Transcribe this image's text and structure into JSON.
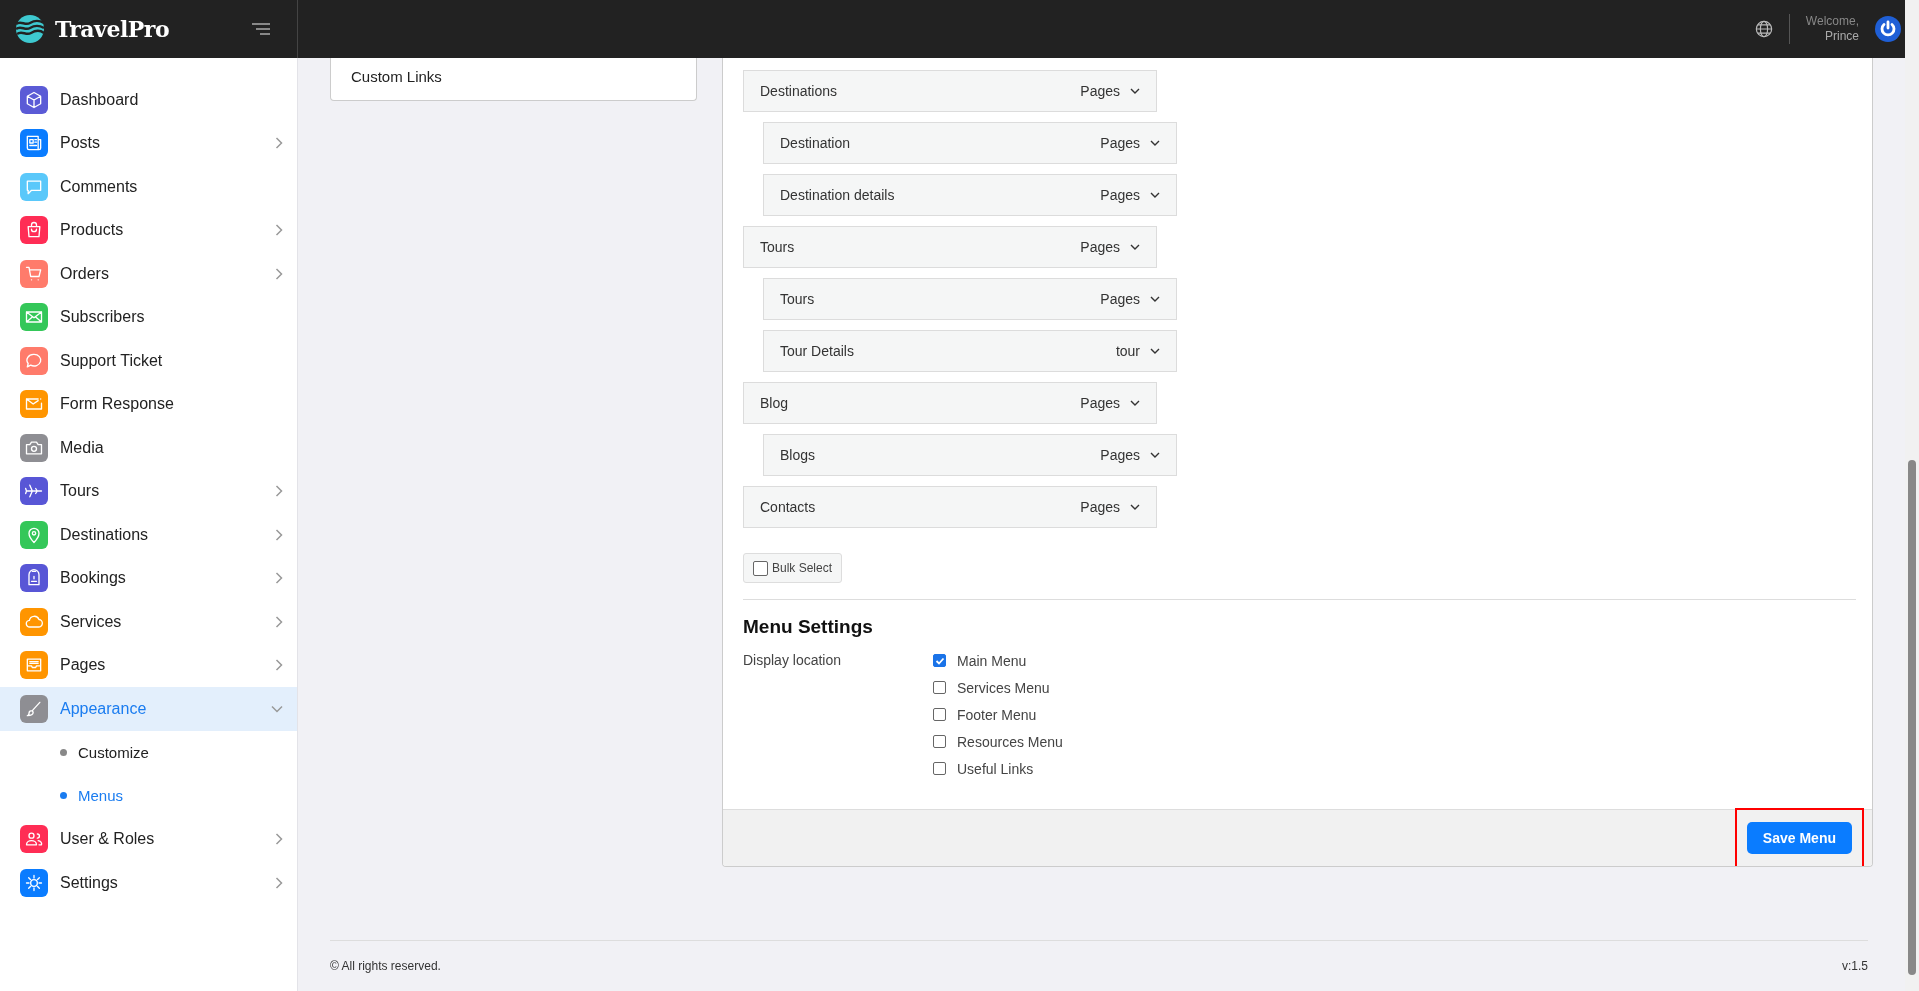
{
  "header": {
    "logo": "TravelPro",
    "welcome": "Welcome,",
    "user": "Prince"
  },
  "sidebar": {
    "items": [
      {
        "label": "Dashboard",
        "color": "#5b5bd6",
        "selected": false
      },
      {
        "label": "Posts",
        "color": "#0a7cff",
        "expanded": false,
        "selected": false
      },
      {
        "label": "Comments",
        "color": "#5ac8fa",
        "selected": false
      },
      {
        "label": "Products",
        "color": "#ff2d55",
        "expanded": false,
        "selected": false
      },
      {
        "label": "Orders",
        "color": "#ff7b6b",
        "expanded": false,
        "selected": false
      },
      {
        "label": "Subscribers",
        "color": "#34c759",
        "selected": false
      },
      {
        "label": "Support Ticket",
        "color": "#ff7b6b",
        "selected": false
      },
      {
        "label": "Form Response",
        "color": "#ff9500",
        "selected": false
      },
      {
        "label": "Media",
        "color": "#8e8e93",
        "selected": false
      },
      {
        "label": "Tours",
        "color": "#5856d6",
        "expanded": false,
        "selected": false
      },
      {
        "label": "Destinations",
        "color": "#34c759",
        "expanded": false,
        "selected": false
      },
      {
        "label": "Bookings",
        "color": "#5856d6",
        "expanded": false,
        "selected": false
      },
      {
        "label": "Services",
        "color": "#ff9500",
        "expanded": false,
        "selected": false
      },
      {
        "label": "Pages",
        "color": "#ff9500",
        "expanded": false,
        "selected": false
      },
      {
        "label": "Appearance",
        "color": "#8e8e93",
        "expanded": true,
        "selected": true,
        "children": [
          {
            "label": "Customize",
            "selected": false
          },
          {
            "label": "Menus",
            "selected": true
          }
        ]
      },
      {
        "label": "User & Roles",
        "color": "#ff2d55",
        "expanded": false,
        "selected": false
      },
      {
        "label": "Settings",
        "color": "#0a7cff",
        "expanded": false,
        "selected": false
      }
    ]
  },
  "left_panel": {
    "title": "Custom Links"
  },
  "menu_structure": {
    "items": [
      {
        "label": "Destinations",
        "type": "Pages",
        "children": [
          {
            "label": "Destination",
            "type": "Pages"
          },
          {
            "label": "Destination details",
            "type": "Pages"
          }
        ]
      },
      {
        "label": "Tours",
        "type": "Pages",
        "children": [
          {
            "label": "Tours",
            "type": "Pages"
          },
          {
            "label": "Tour Details",
            "type": "tour"
          }
        ]
      },
      {
        "label": "Blog",
        "type": "Pages",
        "children": [
          {
            "label": "Blogs",
            "type": "Pages"
          }
        ]
      },
      {
        "label": "Contacts",
        "type": "Pages"
      }
    ]
  },
  "bulk_select": {
    "label": "Bulk Select",
    "checked": false
  },
  "menu_settings": {
    "title": "Menu Settings",
    "display_location_label": "Display location",
    "locations": [
      {
        "label": "Main Menu",
        "checked": true
      },
      {
        "label": "Services Menu",
        "checked": false
      },
      {
        "label": "Footer Menu",
        "checked": false
      },
      {
        "label": "Resources Menu",
        "checked": false
      },
      {
        "label": "Useful Links",
        "checked": false
      }
    ]
  },
  "save_button": {
    "label": "Save Menu",
    "highlighted": true
  },
  "footer": {
    "copyright": "© All rights reserved.",
    "version": "v:1.5"
  }
}
